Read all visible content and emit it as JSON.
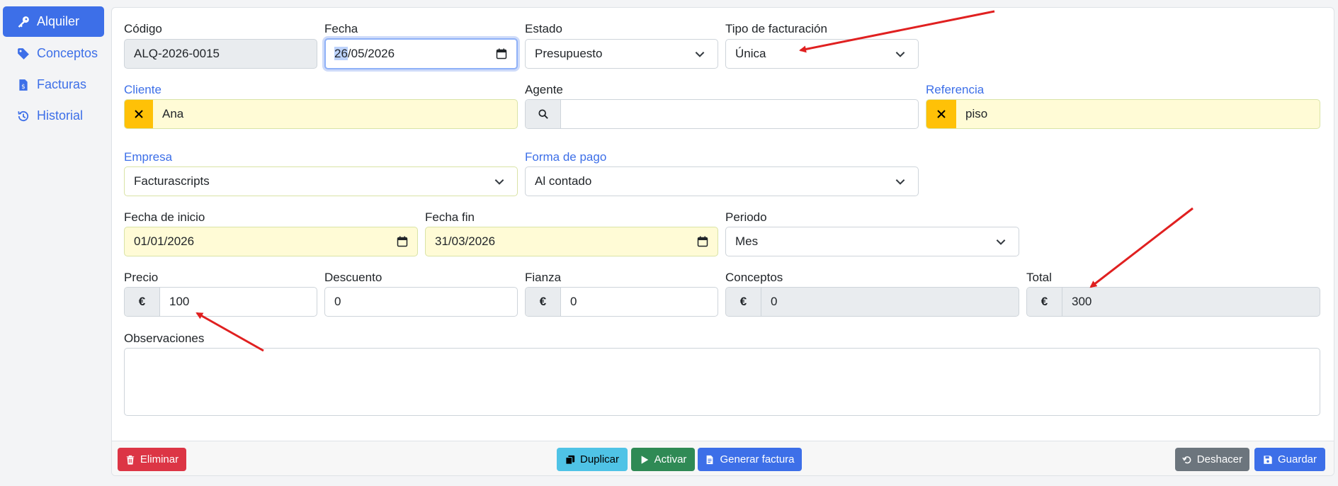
{
  "sidebar": {
    "items": [
      {
        "label": "Alquiler",
        "icon": "key-icon",
        "active": true
      },
      {
        "label": "Conceptos",
        "icon": "tags-icon"
      },
      {
        "label": "Facturas",
        "icon": "invoice-icon"
      },
      {
        "label": "Historial",
        "icon": "history-icon"
      }
    ]
  },
  "form": {
    "codigo": {
      "label": "Código",
      "value": "ALQ-2026-0015"
    },
    "fecha": {
      "label": "Fecha",
      "value_selected": "26",
      "value_rest": "/05/2026"
    },
    "estado": {
      "label": "Estado",
      "value": "Presupuesto"
    },
    "tipo_facturacion": {
      "label": "Tipo de facturación",
      "value": "Única"
    },
    "cliente": {
      "label": "Cliente",
      "value": "Ana"
    },
    "agente": {
      "label": "Agente",
      "value": ""
    },
    "referencia": {
      "label": "Referencia",
      "value": "piso"
    },
    "empresa": {
      "label": "Empresa",
      "value": "Facturascripts"
    },
    "forma_pago": {
      "label": "Forma de pago",
      "value": "Al contado"
    },
    "fecha_inicio": {
      "label": "Fecha de inicio",
      "value": "01/01/2026"
    },
    "fecha_fin": {
      "label": "Fecha fin",
      "value": "31/03/2026"
    },
    "periodo": {
      "label": "Periodo",
      "value": "Mes"
    },
    "precio": {
      "label": "Precio",
      "currency": "€",
      "value": "100"
    },
    "descuento": {
      "label": "Descuento",
      "value": "0"
    },
    "fianza": {
      "label": "Fianza",
      "currency": "€",
      "value": "0"
    },
    "conceptos": {
      "label": "Conceptos",
      "currency": "€",
      "value": "0"
    },
    "total": {
      "label": "Total",
      "currency": "€",
      "value": "300"
    },
    "observaciones": {
      "label": "Observaciones",
      "value": ""
    }
  },
  "footer": {
    "eliminar": "Eliminar",
    "duplicar": "Duplicar",
    "activar": "Activar",
    "generar_factura": "Generar factura",
    "deshacer": "Deshacer",
    "guardar": "Guardar"
  },
  "colors": {
    "primary": "#3d6fe8",
    "danger": "#dc3545",
    "success": "#2f8a55",
    "info": "#4fc3e6",
    "secondary": "#6c757d",
    "warning": "#ffc107",
    "annotation": "#e02020"
  }
}
